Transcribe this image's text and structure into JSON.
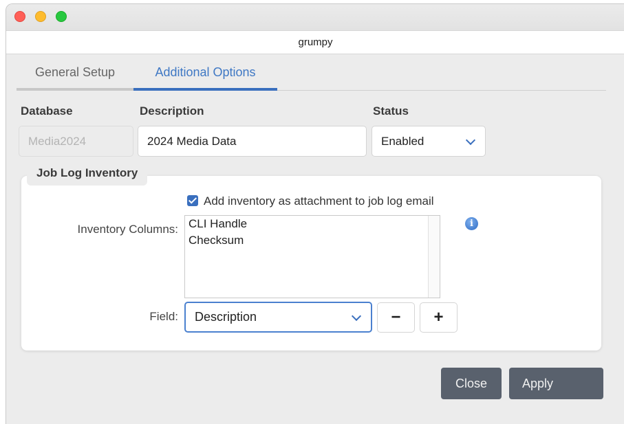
{
  "window": {
    "title": "grumpy"
  },
  "tabs": [
    {
      "label": "General Setup",
      "active": false
    },
    {
      "label": "Additional Options",
      "active": true
    }
  ],
  "form": {
    "database": {
      "label": "Database",
      "value": "Media2024",
      "disabled": true
    },
    "description": {
      "label": "Description",
      "value": "2024 Media Data"
    },
    "status": {
      "label": "Status",
      "value": "Enabled"
    }
  },
  "job_log_inventory": {
    "title": "Job Log Inventory",
    "attach_checkbox": {
      "label": "Add inventory as attachment to job log email",
      "checked": true
    },
    "inventory_columns": {
      "label": "Inventory Columns:",
      "items": [
        "CLI Handle",
        "Checksum"
      ]
    },
    "field": {
      "label": "Field:",
      "value": "Description"
    },
    "remove_symbol": "−",
    "add_symbol": "+",
    "info_symbol": "i"
  },
  "footer": {
    "close_label": "Close",
    "apply_label": "Apply"
  },
  "colors": {
    "accent": "#3a6fbe",
    "button": "#59616d"
  }
}
